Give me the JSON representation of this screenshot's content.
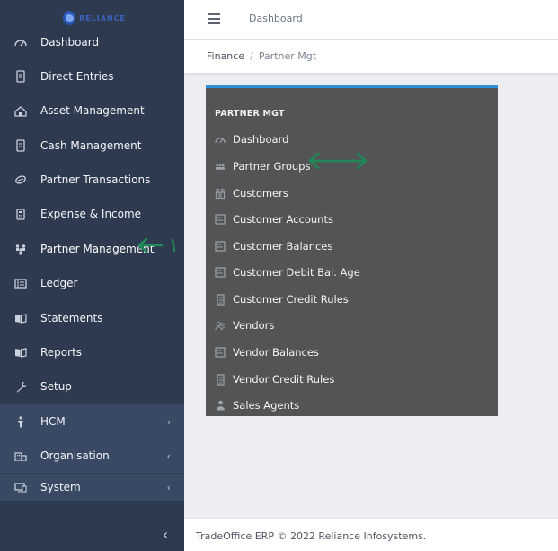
{
  "sidebar": {
    "logo_text": "RELIANCE",
    "items": [
      {
        "label": "Dashboard",
        "icon": "dashboard-icon"
      },
      {
        "label": "Direct Entries",
        "icon": "entries-icon"
      },
      {
        "label": "Asset Management",
        "icon": "asset-icon"
      },
      {
        "label": "Cash Management",
        "icon": "cash-icon"
      },
      {
        "label": "Partner Transactions",
        "icon": "handshake-icon"
      },
      {
        "label": "Expense & Income",
        "icon": "calculator-icon"
      },
      {
        "label": "Partner Management",
        "icon": "people-icon"
      },
      {
        "label": "Ledger",
        "icon": "ledger-icon"
      },
      {
        "label": "Statements",
        "icon": "book-icon"
      },
      {
        "label": "Reports",
        "icon": "book-icon"
      },
      {
        "label": "Setup",
        "icon": "wrench-icon"
      },
      {
        "label": "HCM",
        "icon": "person-icon"
      },
      {
        "label": "Organisation",
        "icon": "building-icon"
      },
      {
        "label": "System",
        "icon": "monitor-icon"
      }
    ],
    "collapse_glyph": "‹"
  },
  "header": {
    "title": "Dashboard"
  },
  "breadcrumb": {
    "parent": "Finance",
    "separator": "/",
    "current": "Partner Mgt"
  },
  "panel": {
    "heading": "PARTNER MGT",
    "items": [
      {
        "label": "Dashboard",
        "icon": "dashboard-icon"
      },
      {
        "label": "Partner Groups",
        "icon": "group-icon"
      },
      {
        "label": "Customers",
        "icon": "customers-icon"
      },
      {
        "label": "Customer Accounts",
        "icon": "account-icon"
      },
      {
        "label": "Customer Balances",
        "icon": "account-icon"
      },
      {
        "label": "Customer Debit Bal. Age",
        "icon": "account-icon"
      },
      {
        "label": "Customer Credit Rules",
        "icon": "document-icon"
      },
      {
        "label": "Vendors",
        "icon": "vendors-icon"
      },
      {
        "label": "Vendor Balances",
        "icon": "account-icon"
      },
      {
        "label": "Vendor Credit Rules",
        "icon": "document-icon"
      },
      {
        "label": "Sales Agents",
        "icon": "agent-icon"
      }
    ]
  },
  "footer": {
    "text": "TradeOffice ERP © 2022 Reliance Infosystems."
  },
  "colors": {
    "sidebar_bg": "#2e3a4f",
    "sidebar_group_bg": "#3a4963",
    "panel_bg": "#525456",
    "panel_accent": "#2f8fd8",
    "annotation": "#1f8a57"
  }
}
